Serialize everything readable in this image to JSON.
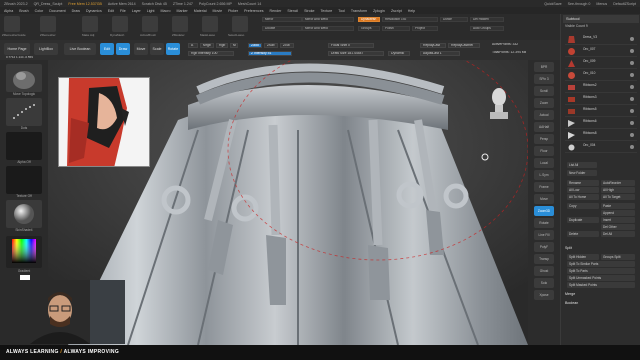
{
  "titlebar": {
    "app": "ZBrush 2023.2",
    "file": "QR_Dress_Sculpt",
    "stats": [
      "Free Mem 12.537GB",
      "Active Mem 2614",
      "Scratch Disk 45",
      "ZTime 1.247",
      "PolyCount 2.656 MP",
      "MeshCount 14"
    ],
    "right": [
      "QuickSave",
      "See-through 0",
      "Menus",
      "DefaultZScript"
    ]
  },
  "menubar": {
    "items": [
      "Alpha",
      "Brush",
      "Color",
      "Document",
      "Draw",
      "Dynamics",
      "Edit",
      "File",
      "Layer",
      "Light",
      "Macro",
      "Marker",
      "Material",
      "Movie",
      "Picker",
      "Preferences",
      "Render",
      "Stencil",
      "Stroke",
      "Texture",
      "Tool",
      "Transform",
      "Zplugin",
      "Zscript",
      "Help"
    ]
  },
  "toptray": {
    "buttons": [
      "ZRemesherGuide",
      "ZRemesher",
      "Make Adj",
      "DynaMesh",
      "ActiveBrush",
      "ZModeler",
      "MaskLasso",
      "SelectLasso",
      "TrimCurve",
      "Resolution"
    ],
    "mid": [
      "Mirror",
      "Mirror And Weld",
      "DynaMesh",
      "Resolution 192",
      "Divide",
      "Del Hidden",
      "Double",
      "Mirror And Weld",
      "Groups",
      "Polish",
      "Project",
      "Auto Groups"
    ]
  },
  "toolbar2": {
    "home": "Home Page",
    "lightbox": "LightBox",
    "liveboolean": "Live Boolean",
    "edit": "Edit",
    "draw": "Draw",
    "move": "Move",
    "scale": "Scale",
    "rotate": "Rotate",
    "a": "A",
    "mrgb": "Mrgb",
    "rgb": "Rgb",
    "m": "M",
    "zadd": "Zadd",
    "zsub": "Zsub",
    "zcut": "Zcut",
    "rgb_intensity": "Rgb Intensity 100",
    "z_intensity": "Z Intensity 51",
    "focal_shift": "Focal Shift 0",
    "draw_size": "Draw Size 181.44547",
    "dynamic": "Dynamic",
    "replay_last": "ReplayLast",
    "replay_last_rel": "ReplayLastRel",
    "active_points": "ActivePoints: 332",
    "adjust_last": "AdjustLast 1",
    "total_points": "TotalPoints: 12.394 Mil",
    "coords": "0.7712 1.144 -0.559"
  },
  "leftshelf": {
    "items": [
      "Move Topologic",
      "Dots",
      "Alpha Off",
      "Texture Off",
      "SkinShade4",
      "Gradient"
    ]
  },
  "rightdock": {
    "items": [
      "BPR",
      "SPix 3",
      "Scroll",
      "Zoom",
      "Actual",
      "AAHalf",
      "Persp",
      "Floor",
      "Local",
      "L.Sym",
      "Frame",
      "Move",
      "Zoom3D",
      "Rotate",
      "Line Fill",
      "PolyF",
      "Transp",
      "Ghost",
      "Solo",
      "Xpose"
    ]
  },
  "subtool": {
    "title": "Subtool",
    "visible_count": "Visible Count 9",
    "rows": [
      {
        "label": "Dress_V3",
        "color": "#a93a2e"
      },
      {
        "label": "Oro_007",
        "color": "#c24232"
      },
      {
        "label": "Oro_009",
        "color": "#b53a30"
      },
      {
        "label": "Oro_010",
        "color": "#c84a3a"
      },
      {
        "label": "Ribbons2",
        "color": "#b8413a"
      },
      {
        "label": "Ribbons3",
        "color": "#a73828"
      },
      {
        "label": "Ribbons5",
        "color": "#9a3828"
      },
      {
        "label": "Ribbons6",
        "color": "#c9c9c9"
      },
      {
        "label": "Ribbons8",
        "color": "#d6d6d6"
      },
      {
        "label": "Oro_004",
        "color": "#cfcfcf"
      }
    ],
    "list_all": "List All",
    "new_folder": "New Folder",
    "rename": "Rename",
    "auto_reorder": "AutoReorder",
    "all_low": "All Low",
    "all_high": "All High",
    "all_to_home": "All To Home",
    "all_to_target": "All To Target",
    "copy": "Copy",
    "paste": "Paste",
    "append": "Append",
    "duplicate": "Duplicate",
    "insert": "Insert",
    "delete": "Delete",
    "del_other": "Del Other",
    "del_all": "Del All",
    "split_section": "Split",
    "split_hidden": "Split Hidden",
    "groups_split": "Groups Split",
    "split_to_similar": "Split To Similar Parts",
    "split_to_parts": "Split To Parts",
    "split_unmasked": "Split Unmasked Points",
    "split_masked": "Split Masked Points",
    "merge": "Merge",
    "boolean": "Boolean"
  },
  "banner": {
    "left": "ALWAYS LEARNING",
    "sep": "/",
    "right": "ALWAYS IMPROVING"
  },
  "colors": {
    "accent_blue": "#2a8ed8",
    "accent_orange": "#d8751f"
  }
}
